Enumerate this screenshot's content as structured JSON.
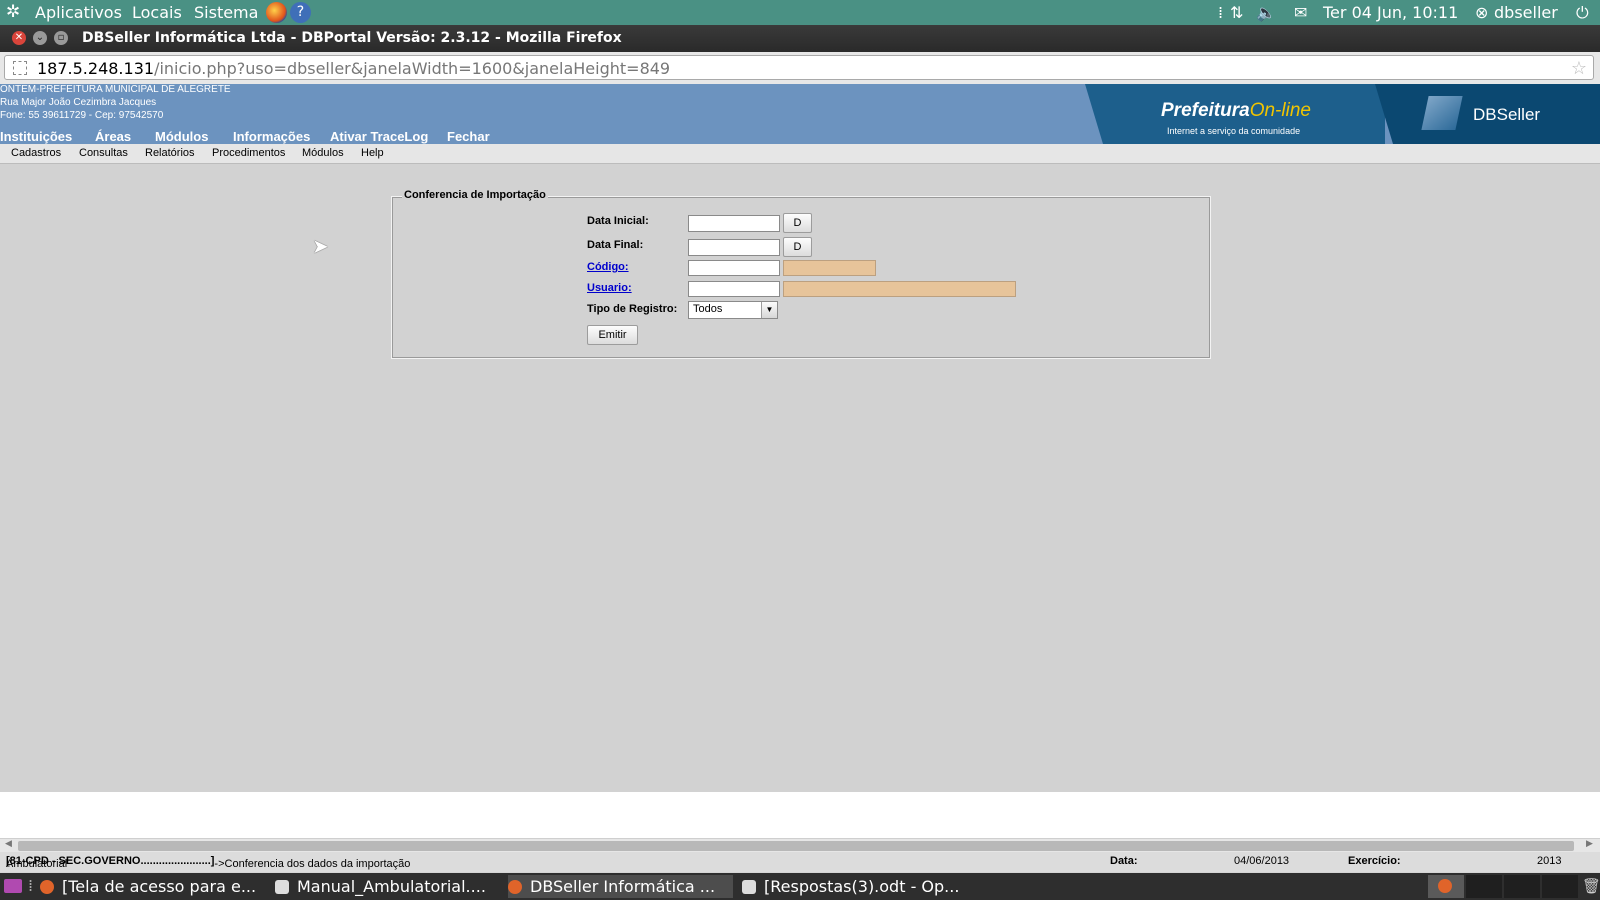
{
  "gnome_panel": {
    "menus": [
      "Aplicativos",
      "Locais",
      "Sistema"
    ],
    "datetime": "Ter 04 Jun, 10:11",
    "user": "dbseller"
  },
  "window": {
    "title": "DBSeller Informática Ltda - DBPortal Versão: 2.3.12 - Mozilla Firefox",
    "url_host": "187.5.248.131",
    "url_path": "/inicio.php?uso=dbseller&janelaWidth=1600&janelaHeight=849"
  },
  "portal": {
    "org_line1": "ONTEM-PREFEITURA MUNICIPAL DE ALEGRETE",
    "org_line2": "Rua Major João Cezimbra Jacques",
    "org_line3": "Fone: 55 39611729  -  Cep: 97542570",
    "logo1_a": "Prefeitura",
    "logo1_b": "On-line",
    "logo1_tag": "Internet a serviço da comunidade",
    "logo2": "DBSeller",
    "main_menu": [
      "Instituições",
      "Áreas",
      "Módulos",
      "Informações",
      "Ativar TraceLog",
      "Fechar"
    ],
    "sub_menu": [
      "Cadastros",
      "Consultas",
      "Relatórios",
      "Procedimentos",
      "Módulos",
      "Help"
    ]
  },
  "form": {
    "legend": "Conferencia de Importação",
    "data_inicial_label": "Data Inicial:",
    "data_final_label": "Data Final:",
    "codigo_label": "Código:",
    "usuario_label": "Usuario:",
    "tipo_label": "Tipo de Registro:",
    "tipo_value": "Todos",
    "date_button": "D",
    "emitir": "Emitir"
  },
  "statusbar": {
    "path_a": "Ambulatorial",
    "path_b": "[81-CPD - SEC.GOVERNO.......................]",
    "path_c": "->Conferencia dos dados da importação",
    "data_label": "Data:",
    "data_value": "04/06/2013",
    "exercicio_label": "Exercício:",
    "exercicio_value": "2013"
  },
  "taskbar": {
    "items": [
      "[Tela de acesso para e...",
      "Manual_Ambulatorial....",
      "DBSeller Informática ...",
      "[Respostas(3).odt - Op..."
    ]
  },
  "colors": {
    "panel": "#4a9184",
    "header": "#6c93bf",
    "readonly_field": "#e7c49a",
    "link": "#0000cc"
  }
}
